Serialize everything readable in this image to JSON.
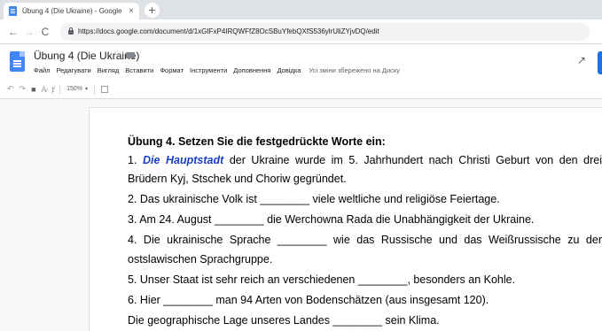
{
  "browser": {
    "tab_title": "Übung 4 (Die Ukraine) - Google",
    "tab_close": "×",
    "new_tab": "+",
    "nav_back": "←",
    "nav_forward": "→",
    "nav_reload": "C",
    "url": "https://docs.google.com/document/d/1xGIFxP4IRQWFfZ8OcSBuYfebQXfS536ylrUliZYjvDQ/edit"
  },
  "docs": {
    "title": "Übung 4 (Die Ukraine)",
    "star": "☆",
    "menu": [
      "Файл",
      "Редагувати",
      "Вигляд",
      "Вставити",
      "Формат",
      "Інструменти",
      "Доповнення",
      "Довідка"
    ],
    "save_status": "Усі зміни збережено на Диску",
    "activity": "↗"
  },
  "toolbar": {
    "undo": "↶",
    "redo": "↷",
    "print": "■",
    "spell": "A̷",
    "paint": "ⱦ",
    "zoom": "150%",
    "zoom_caret": "▾",
    "insert": "+"
  },
  "document": {
    "heading": "Übung 4. Setzen Sie die festgedrückte Worte ein:",
    "l1_pre": "1. ",
    "l1_hl": "Die Hauptstadt",
    "l1_post": " der Ukraine wurde im 5. Jahrhundert nach Christi Geburt von den drei",
    "l2": "Brüdern Kyj, Stschek und Choriw gegründet.",
    "l3": "2. Das ukrainische Volk ist ________ viele weltliche und religiöse Feiertage.",
    "l4": "3. Am 24. August ________ die Werchowna Rada die Unabhängigkeit der Ukraine.",
    "l5": "4. Die ukrainische Sprache ________ wie das Russische und das Weißrussische zu der",
    "l6": "ostslawischen Sprachgruppe.",
    "l7": "5. Unser Staat ist sehr reich an verschiedenen ________, besonders an Kohle.",
    "l8": "6. Hier ________ man 94 Arten von Bodenschätzen (aus insgesamt 120).",
    "l9": "Die geographische Lage unseres Landes ________ sein Klima."
  }
}
